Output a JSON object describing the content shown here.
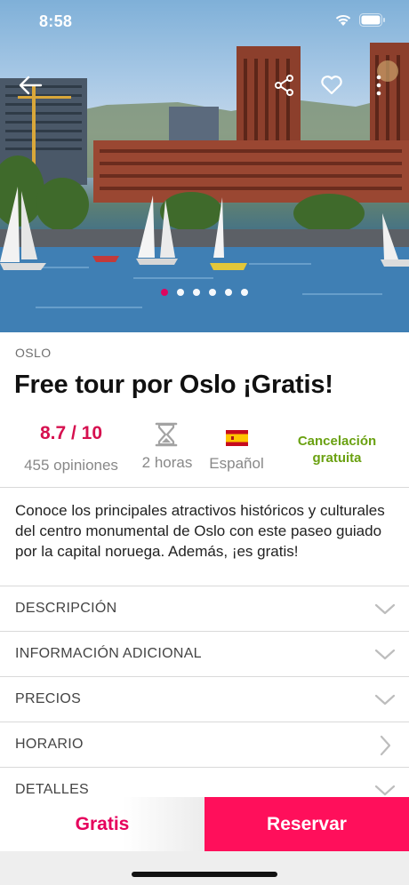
{
  "status_bar": {
    "time": "8:58"
  },
  "hero": {
    "image_alt": "Oslo City Hall and harbour with sailboats",
    "slide_count": 6,
    "active_slide": 1
  },
  "tour": {
    "city": "OSLO",
    "title": "Free tour por Oslo ¡Gratis!",
    "rating": "8.7 / 10",
    "reviews": "455 opiniones",
    "duration": "2 horas",
    "language": "Español",
    "cancellation": "Cancelación gratuita",
    "summary": "Conoce los principales atractivos históricos y culturales del centro monumental de Oslo con este paseo guiado por la capital noruega. Además, ¡es gratis!"
  },
  "sections": [
    {
      "label": "DESCRIPCIÓN",
      "icon": "chevron-down-icon"
    },
    {
      "label": "INFORMACIÓN ADICIONAL",
      "icon": "chevron-down-icon"
    },
    {
      "label": "PRECIOS",
      "icon": "chevron-down-icon"
    },
    {
      "label": "HORARIO",
      "icon": "chevron-right-icon"
    },
    {
      "label": "DETALLES",
      "icon": "chevron-down-icon"
    }
  ],
  "footer": {
    "price": "Gratis",
    "book_label": "Reservar"
  },
  "colors": {
    "brand": "#ff0f5b",
    "rating": "#d6104f",
    "cancellation": "#6aa111"
  }
}
